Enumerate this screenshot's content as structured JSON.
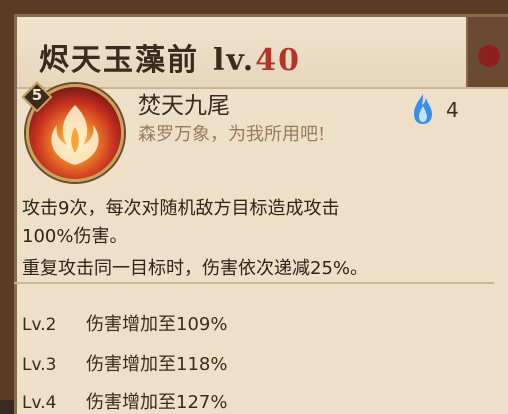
{
  "header": {
    "title": "烬天玉藻前",
    "level_prefix": "lv.",
    "level_value": "40"
  },
  "skill": {
    "level_badge": "5",
    "icon": "fire-fox-icon",
    "name": "焚天九尾",
    "quote": "森罗万象，为我所用吧!",
    "cost_icon": "blue-flame-icon",
    "cost": "4",
    "description_line1": "攻击9次，每次对随机敌方目标造成攻击",
    "description_line2": "100%伤害。",
    "description_line3": "重复攻击同一目标时，伤害依次递减25%。"
  },
  "upgrades": [
    {
      "level": "Lv.2",
      "text": "伤害增加至109%"
    },
    {
      "level": "Lv.3",
      "text": "伤害增加至118%"
    },
    {
      "level": "Lv.4",
      "text": "伤害增加至127%"
    }
  ],
  "colors": {
    "level_number": "#b3352a",
    "panel_bg": "#eee0c8",
    "quote": "#9b7a5a"
  }
}
